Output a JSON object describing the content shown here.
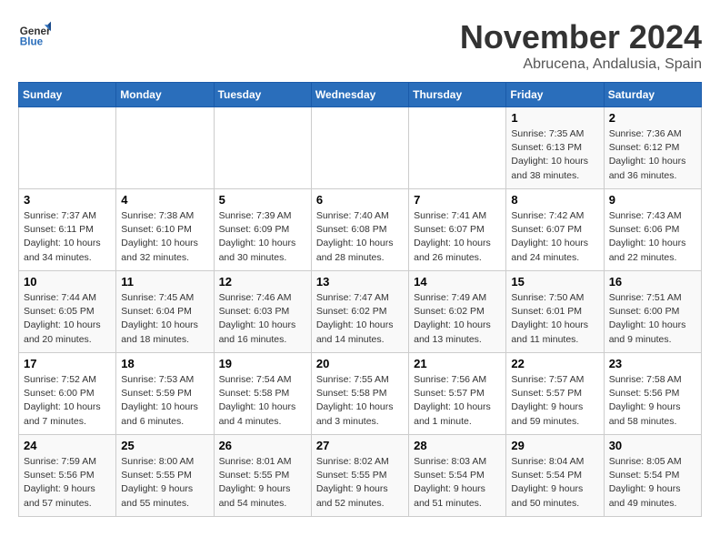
{
  "logo": {
    "line1": "General",
    "line2": "Blue"
  },
  "title": "November 2024",
  "location": "Abrucena, Andalusia, Spain",
  "header": {
    "days": [
      "Sunday",
      "Monday",
      "Tuesday",
      "Wednesday",
      "Thursday",
      "Friday",
      "Saturday"
    ]
  },
  "weeks": [
    {
      "cells": [
        {
          "empty": true
        },
        {
          "empty": true
        },
        {
          "empty": true
        },
        {
          "empty": true
        },
        {
          "empty": true
        },
        {
          "day": 1,
          "sunrise": "Sunrise: 7:35 AM",
          "sunset": "Sunset: 6:13 PM",
          "daylight": "Daylight: 10 hours and 38 minutes."
        },
        {
          "day": 2,
          "sunrise": "Sunrise: 7:36 AM",
          "sunset": "Sunset: 6:12 PM",
          "daylight": "Daylight: 10 hours and 36 minutes."
        }
      ]
    },
    {
      "cells": [
        {
          "day": 3,
          "sunrise": "Sunrise: 7:37 AM",
          "sunset": "Sunset: 6:11 PM",
          "daylight": "Daylight: 10 hours and 34 minutes."
        },
        {
          "day": 4,
          "sunrise": "Sunrise: 7:38 AM",
          "sunset": "Sunset: 6:10 PM",
          "daylight": "Daylight: 10 hours and 32 minutes."
        },
        {
          "day": 5,
          "sunrise": "Sunrise: 7:39 AM",
          "sunset": "Sunset: 6:09 PM",
          "daylight": "Daylight: 10 hours and 30 minutes."
        },
        {
          "day": 6,
          "sunrise": "Sunrise: 7:40 AM",
          "sunset": "Sunset: 6:08 PM",
          "daylight": "Daylight: 10 hours and 28 minutes."
        },
        {
          "day": 7,
          "sunrise": "Sunrise: 7:41 AM",
          "sunset": "Sunset: 6:07 PM",
          "daylight": "Daylight: 10 hours and 26 minutes."
        },
        {
          "day": 8,
          "sunrise": "Sunrise: 7:42 AM",
          "sunset": "Sunset: 6:07 PM",
          "daylight": "Daylight: 10 hours and 24 minutes."
        },
        {
          "day": 9,
          "sunrise": "Sunrise: 7:43 AM",
          "sunset": "Sunset: 6:06 PM",
          "daylight": "Daylight: 10 hours and 22 minutes."
        }
      ]
    },
    {
      "cells": [
        {
          "day": 10,
          "sunrise": "Sunrise: 7:44 AM",
          "sunset": "Sunset: 6:05 PM",
          "daylight": "Daylight: 10 hours and 20 minutes."
        },
        {
          "day": 11,
          "sunrise": "Sunrise: 7:45 AM",
          "sunset": "Sunset: 6:04 PM",
          "daylight": "Daylight: 10 hours and 18 minutes."
        },
        {
          "day": 12,
          "sunrise": "Sunrise: 7:46 AM",
          "sunset": "Sunset: 6:03 PM",
          "daylight": "Daylight: 10 hours and 16 minutes."
        },
        {
          "day": 13,
          "sunrise": "Sunrise: 7:47 AM",
          "sunset": "Sunset: 6:02 PM",
          "daylight": "Daylight: 10 hours and 14 minutes."
        },
        {
          "day": 14,
          "sunrise": "Sunrise: 7:49 AM",
          "sunset": "Sunset: 6:02 PM",
          "daylight": "Daylight: 10 hours and 13 minutes."
        },
        {
          "day": 15,
          "sunrise": "Sunrise: 7:50 AM",
          "sunset": "Sunset: 6:01 PM",
          "daylight": "Daylight: 10 hours and 11 minutes."
        },
        {
          "day": 16,
          "sunrise": "Sunrise: 7:51 AM",
          "sunset": "Sunset: 6:00 PM",
          "daylight": "Daylight: 10 hours and 9 minutes."
        }
      ]
    },
    {
      "cells": [
        {
          "day": 17,
          "sunrise": "Sunrise: 7:52 AM",
          "sunset": "Sunset: 6:00 PM",
          "daylight": "Daylight: 10 hours and 7 minutes."
        },
        {
          "day": 18,
          "sunrise": "Sunrise: 7:53 AM",
          "sunset": "Sunset: 5:59 PM",
          "daylight": "Daylight: 10 hours and 6 minutes."
        },
        {
          "day": 19,
          "sunrise": "Sunrise: 7:54 AM",
          "sunset": "Sunset: 5:58 PM",
          "daylight": "Daylight: 10 hours and 4 minutes."
        },
        {
          "day": 20,
          "sunrise": "Sunrise: 7:55 AM",
          "sunset": "Sunset: 5:58 PM",
          "daylight": "Daylight: 10 hours and 3 minutes."
        },
        {
          "day": 21,
          "sunrise": "Sunrise: 7:56 AM",
          "sunset": "Sunset: 5:57 PM",
          "daylight": "Daylight: 10 hours and 1 minute."
        },
        {
          "day": 22,
          "sunrise": "Sunrise: 7:57 AM",
          "sunset": "Sunset: 5:57 PM",
          "daylight": "Daylight: 9 hours and 59 minutes."
        },
        {
          "day": 23,
          "sunrise": "Sunrise: 7:58 AM",
          "sunset": "Sunset: 5:56 PM",
          "daylight": "Daylight: 9 hours and 58 minutes."
        }
      ]
    },
    {
      "cells": [
        {
          "day": 24,
          "sunrise": "Sunrise: 7:59 AM",
          "sunset": "Sunset: 5:56 PM",
          "daylight": "Daylight: 9 hours and 57 minutes."
        },
        {
          "day": 25,
          "sunrise": "Sunrise: 8:00 AM",
          "sunset": "Sunset: 5:55 PM",
          "daylight": "Daylight: 9 hours and 55 minutes."
        },
        {
          "day": 26,
          "sunrise": "Sunrise: 8:01 AM",
          "sunset": "Sunset: 5:55 PM",
          "daylight": "Daylight: 9 hours and 54 minutes."
        },
        {
          "day": 27,
          "sunrise": "Sunrise: 8:02 AM",
          "sunset": "Sunset: 5:55 PM",
          "daylight": "Daylight: 9 hours and 52 minutes."
        },
        {
          "day": 28,
          "sunrise": "Sunrise: 8:03 AM",
          "sunset": "Sunset: 5:54 PM",
          "daylight": "Daylight: 9 hours and 51 minutes."
        },
        {
          "day": 29,
          "sunrise": "Sunrise: 8:04 AM",
          "sunset": "Sunset: 5:54 PM",
          "daylight": "Daylight: 9 hours and 50 minutes."
        },
        {
          "day": 30,
          "sunrise": "Sunrise: 8:05 AM",
          "sunset": "Sunset: 5:54 PM",
          "daylight": "Daylight: 9 hours and 49 minutes."
        }
      ]
    }
  ]
}
